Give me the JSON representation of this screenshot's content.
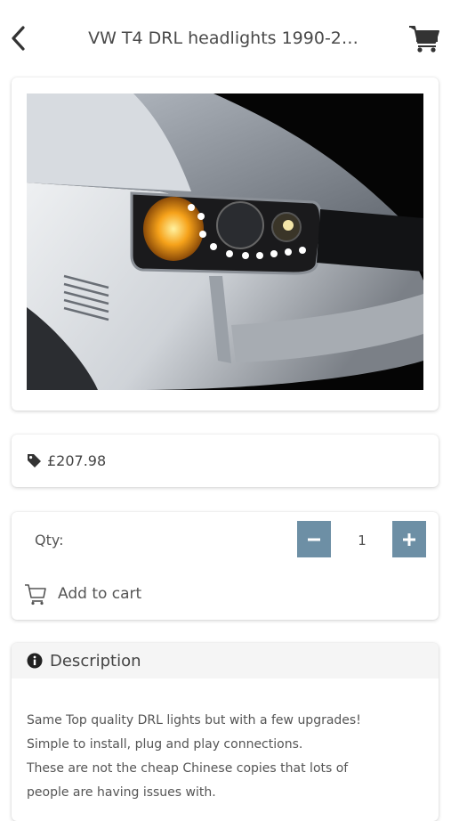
{
  "header": {
    "title": "VW T4 DRL headlights 1990-2…",
    "back_icon": "chevron-left-icon",
    "cart_icon": "shopping-cart-icon"
  },
  "product": {
    "image_subject": "White VW T4 van front headlight with LED daytime running lights lit"
  },
  "price": {
    "icon": "tag-icon",
    "value": "£207.98"
  },
  "cart": {
    "qty_label": "Qty:",
    "qty_value": "1",
    "minus_icon": "minus-icon",
    "plus_icon": "plus-icon",
    "add_to_cart_icon": "cart-outline-icon",
    "add_to_cart_label": "Add to cart"
  },
  "description": {
    "icon": "info-circle-icon",
    "title": "Description",
    "lines": [
      "Same Top quality  DRL lights but with a few upgrades!",
      "Simple to install, plug and play connections.",
      "These are not the cheap Chinese copies that lots of",
      "people are having issues with."
    ]
  },
  "colors": {
    "qty_button": "#6d8fa5",
    "text": "#444444",
    "card_header": "#f5f5f5"
  }
}
